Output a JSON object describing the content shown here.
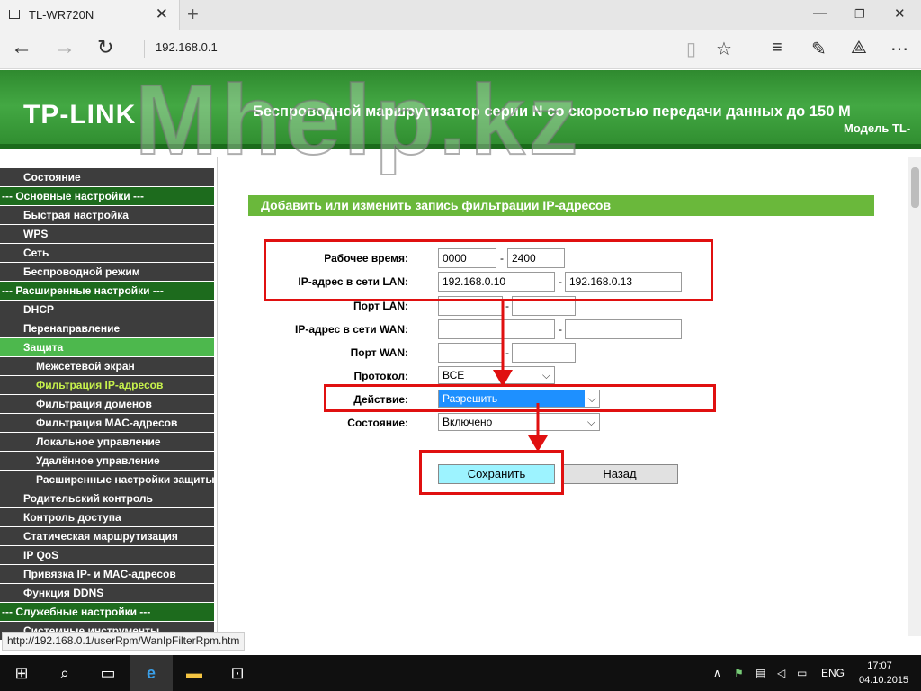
{
  "browser": {
    "tab_title": "TL-WR720N",
    "address": "192.168.0.1",
    "status_url": "http://192.168.0.1/userRpm/WanIpFilterRpm.htm"
  },
  "router": {
    "logo": "TP-LINK",
    "header_title": "Беспроводной маршрутизатор серии N со скоростью передачи данных до 150 М",
    "header_model": "Модель TL-",
    "watermark": "Mhelp.kz"
  },
  "sidebar": {
    "items": [
      {
        "label": "Состояние",
        "kind": "lvl1"
      },
      {
        "label": "--- Основные настройки ---",
        "kind": "sec"
      },
      {
        "label": "Быстрая настройка",
        "kind": "lvl1"
      },
      {
        "label": "WPS",
        "kind": "lvl1"
      },
      {
        "label": "Сеть",
        "kind": "lvl1"
      },
      {
        "label": "Беспроводной режим",
        "kind": "lvl1"
      },
      {
        "label": "--- Расширенные настройки ---",
        "kind": "sec"
      },
      {
        "label": "DHCP",
        "kind": "lvl1"
      },
      {
        "label": "Перенаправление",
        "kind": "lvl1"
      },
      {
        "label": "Защита",
        "kind": "active1"
      },
      {
        "label": "Межсетевой экран",
        "kind": "lvl2"
      },
      {
        "label": "Фильтрация IP-адресов",
        "kind": "active2"
      },
      {
        "label": "Фильтрация доменов",
        "kind": "lvl2"
      },
      {
        "label": "Фильтрация MAC-адресов",
        "kind": "lvl2"
      },
      {
        "label": "Локальное управление",
        "kind": "lvl2"
      },
      {
        "label": "Удалённое управление",
        "kind": "lvl2"
      },
      {
        "label": "Расширенные настройки защиты",
        "kind": "lvl2"
      },
      {
        "label": "Родительский контроль",
        "kind": "lvl1"
      },
      {
        "label": "Контроль доступа",
        "kind": "lvl1"
      },
      {
        "label": "Статическая маршрутизация",
        "kind": "lvl1"
      },
      {
        "label": "IP QoS",
        "kind": "lvl1"
      },
      {
        "label": "Привязка IP- и MAC-адресов",
        "kind": "lvl1"
      },
      {
        "label": "Функция DDNS",
        "kind": "lvl1"
      },
      {
        "label": "--- Служебные настройки ---",
        "kind": "sec"
      },
      {
        "label": "Системные инструменты",
        "kind": "lvl1"
      }
    ]
  },
  "form": {
    "title": "Добавить или изменить запись фильтрации IP-адресов",
    "work_time_label": "Рабочее время:",
    "work_time_from": "0000",
    "work_time_to": "2400",
    "lan_ip_label": "IP-адрес в сети LAN:",
    "lan_ip_from": "192.168.0.10",
    "lan_ip_to": "192.168.0.13",
    "lan_port_label": "Порт LAN:",
    "lan_port_from": "",
    "lan_port_to": "",
    "wan_ip_label": "IP-адрес в сети WAN:",
    "wan_ip_from": "",
    "wan_ip_to": "",
    "wan_port_label": "Порт WAN:",
    "wan_port_from": "",
    "wan_port_to": "",
    "protocol_label": "Протокол:",
    "protocol_value": "ВСЕ",
    "action_label": "Действие:",
    "action_value": "Разрешить",
    "status_label": "Состояние:",
    "status_value": "Включено",
    "dash": "-",
    "save_button": "Сохранить",
    "back_button": "Назад"
  },
  "taskbar": {
    "lang": "ENG",
    "time": "17:07",
    "date": "04.10.2015"
  },
  "colors": {
    "header_green": "#43a843",
    "section_green": "#1d6b1d",
    "active_text": "#c7f24c",
    "highlight_red": "#e01010",
    "selected_blue": "#1e90ff",
    "save_cyan": "#9df3ff"
  }
}
